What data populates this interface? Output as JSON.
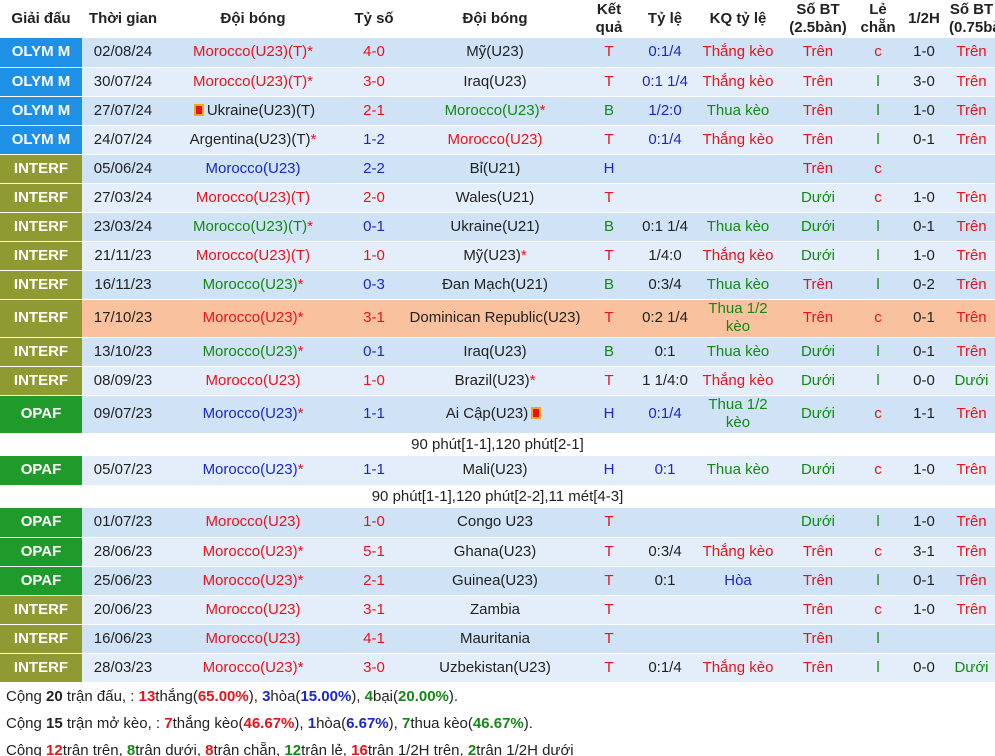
{
  "headers": [
    "Giải đấu",
    "Thời gian",
    "Đội bóng",
    "Tỷ số",
    "Đội bóng",
    "Kết quả",
    "Tỷ lệ",
    "KQ tỷ lệ",
    "Số BT (2.5bàn)",
    "Lẻ chẵn",
    "1/2H",
    "Số BT (0.75bàn)"
  ],
  "colors": {
    "olym": "#1e90e6",
    "interf": "#8f9a32",
    "opaf": "#1f9b2c",
    "row_even": "#cfe2f6",
    "row_odd": "#e4eefa",
    "highlight": "#f9c19e",
    "red": "#e8131b",
    "green": "#128a12",
    "blue": "#1b28c8"
  },
  "rows": [
    {
      "league": "OLYM M",
      "lc": "olym",
      "date": "02/08/24",
      "home": "Morocco(U23)(T)",
      "hstar": "*",
      "hc": "red",
      "hflag": false,
      "score": "4-0",
      "sc": "red",
      "away": "Mỹ(U23)",
      "astar": "",
      "ac": "dark",
      "aflag": false,
      "res": "T",
      "rc": "red",
      "odds": "0:1/4",
      "oc": "blue",
      "kq": "Thắng kèo",
      "kc": "red",
      "bt": "Trên",
      "bc": "red",
      "lec": "c",
      "lecc": "red",
      "half": "1-0",
      "bt2": "Trên",
      "b2c": "red"
    },
    {
      "league": "OLYM M",
      "lc": "olym",
      "date": "30/07/24",
      "home": "Morocco(U23)(T)",
      "hstar": "*",
      "hc": "red",
      "hflag": false,
      "score": "3-0",
      "sc": "red",
      "away": "Iraq(U23)",
      "astar": "",
      "ac": "dark",
      "aflag": false,
      "res": "T",
      "rc": "red",
      "odds": "0:1 1/4",
      "oc": "blue",
      "kq": "Thắng kèo",
      "kc": "red",
      "bt": "Trên",
      "bc": "red",
      "lec": "l",
      "lecc": "green",
      "half": "3-0",
      "bt2": "Trên",
      "b2c": "red"
    },
    {
      "league": "OLYM M",
      "lc": "olym",
      "date": "27/07/24",
      "home": "Ukraine(U23)(T)",
      "hstar": "",
      "hc": "dark",
      "hflag": true,
      "score": "2-1",
      "sc": "red",
      "away": "Morocco(U23)",
      "astar": "*",
      "ac": "green",
      "aflag": false,
      "res": "B",
      "rc": "green",
      "odds": "1/2:0",
      "oc": "blue",
      "kq": "Thua kèo",
      "kc": "green",
      "bt": "Trên",
      "bc": "red",
      "lec": "l",
      "lecc": "green",
      "half": "1-0",
      "bt2": "Trên",
      "b2c": "red"
    },
    {
      "league": "OLYM M",
      "lc": "olym",
      "date": "24/07/24",
      "home": "Argentina(U23)(T)",
      "hstar": "*",
      "hc": "dark",
      "hflag": false,
      "score": "1-2",
      "sc": "blue",
      "away": "Morocco(U23)",
      "astar": "",
      "ac": "red",
      "aflag": false,
      "res": "T",
      "rc": "red",
      "odds": "0:1/4",
      "oc": "blue",
      "kq": "Thắng kèo",
      "kc": "red",
      "bt": "Trên",
      "bc": "red",
      "lec": "l",
      "lecc": "green",
      "half": "0-1",
      "bt2": "Trên",
      "b2c": "red"
    },
    {
      "league": "INTERF",
      "lc": "interf",
      "date": "05/06/24",
      "home": "Morocco(U23)",
      "hstar": "",
      "hc": "blue",
      "hflag": false,
      "score": "2-2",
      "sc": "blue",
      "away": "Bỉ(U21)",
      "astar": "",
      "ac": "dark",
      "aflag": false,
      "res": "H",
      "rc": "blue",
      "odds": "",
      "oc": "blue",
      "kq": "",
      "kc": "dark",
      "bt": "Trên",
      "bc": "red",
      "lec": "c",
      "lecc": "red",
      "half": "",
      "bt2": "",
      "b2c": "red"
    },
    {
      "league": "INTERF",
      "lc": "interf",
      "date": "27/03/24",
      "home": "Morocco(U23)(T)",
      "hstar": "",
      "hc": "red",
      "hflag": false,
      "score": "2-0",
      "sc": "red",
      "away": "Wales(U21)",
      "astar": "",
      "ac": "dark",
      "aflag": false,
      "res": "T",
      "rc": "red",
      "odds": "",
      "oc": "blue",
      "kq": "",
      "kc": "dark",
      "bt": "Dưới",
      "bc": "green",
      "lec": "c",
      "lecc": "red",
      "half": "1-0",
      "bt2": "Trên",
      "b2c": "red"
    },
    {
      "league": "INTERF",
      "lc": "interf",
      "date": "23/03/24",
      "home": "Morocco(U23)(T)",
      "hstar": "*",
      "hc": "green",
      "hflag": false,
      "score": "0-1",
      "sc": "blue",
      "away": "Ukraine(U21)",
      "astar": "",
      "ac": "dark",
      "aflag": false,
      "res": "B",
      "rc": "green",
      "odds": "0:1 1/4",
      "oc": "dark",
      "kq": "Thua kèo",
      "kc": "green",
      "bt": "Dưới",
      "bc": "green",
      "lec": "l",
      "lecc": "green",
      "half": "0-1",
      "bt2": "Trên",
      "b2c": "red"
    },
    {
      "league": "INTERF",
      "lc": "interf",
      "date": "21/11/23",
      "home": "Morocco(U23)(T)",
      "hstar": "",
      "hc": "red",
      "hflag": false,
      "score": "1-0",
      "sc": "red",
      "away": "Mỹ(U23)",
      "astar": "*",
      "ac": "dark",
      "aflag": false,
      "res": "T",
      "rc": "red",
      "odds": "1/4:0",
      "oc": "dark",
      "kq": "Thắng kèo",
      "kc": "red",
      "bt": "Dưới",
      "bc": "green",
      "lec": "l",
      "lecc": "green",
      "half": "1-0",
      "bt2": "Trên",
      "b2c": "red"
    },
    {
      "league": "INTERF",
      "lc": "interf",
      "date": "16/11/23",
      "home": "Morocco(U23)",
      "hstar": "*",
      "hc": "green",
      "hflag": false,
      "score": "0-3",
      "sc": "blue",
      "away": "Đan Mạch(U21)",
      "astar": "",
      "ac": "dark",
      "aflag": false,
      "res": "B",
      "rc": "green",
      "odds": "0:3/4",
      "oc": "dark",
      "kq": "Thua kèo",
      "kc": "green",
      "bt": "Trên",
      "bc": "red",
      "lec": "l",
      "lecc": "green",
      "half": "0-2",
      "bt2": "Trên",
      "b2c": "red"
    },
    {
      "league": "INTERF",
      "lc": "interf",
      "date": "17/10/23",
      "home": "Morocco(U23)",
      "hstar": "*",
      "hc": "red",
      "hflag": false,
      "score": "3-1",
      "sc": "red",
      "away": "Dominican Republic(U23)",
      "astar": "",
      "ac": "dark",
      "aflag": false,
      "res": "T",
      "rc": "red",
      "odds": "0:2 1/4",
      "oc": "dark",
      "kq": "Thua 1/2 kèo",
      "kc": "green",
      "bt": "Trên",
      "bc": "red",
      "lec": "c",
      "lecc": "red",
      "half": "0-1",
      "bt2": "Trên",
      "b2c": "red",
      "highlight": true,
      "tall": true
    },
    {
      "league": "INTERF",
      "lc": "interf",
      "date": "13/10/23",
      "home": "Morocco(U23)",
      "hstar": "*",
      "hc": "green",
      "hflag": false,
      "score": "0-1",
      "sc": "blue",
      "away": "Iraq(U23)",
      "astar": "",
      "ac": "dark",
      "aflag": false,
      "res": "B",
      "rc": "green",
      "odds": "0:1",
      "oc": "dark",
      "kq": "Thua kèo",
      "kc": "green",
      "bt": "Dưới",
      "bc": "green",
      "lec": "l",
      "lecc": "green",
      "half": "0-1",
      "bt2": "Trên",
      "b2c": "red"
    },
    {
      "league": "INTERF",
      "lc": "interf",
      "date": "08/09/23",
      "home": "Morocco(U23)",
      "hstar": "",
      "hc": "red",
      "hflag": false,
      "score": "1-0",
      "sc": "red",
      "away": "Brazil(U23)",
      "astar": "*",
      "ac": "dark",
      "aflag": false,
      "res": "T",
      "rc": "red",
      "odds": "1 1/4:0",
      "oc": "dark",
      "kq": "Thắng kèo",
      "kc": "red",
      "bt": "Dưới",
      "bc": "green",
      "lec": "l",
      "lecc": "green",
      "half": "0-0",
      "bt2": "Dưới",
      "b2c": "green"
    },
    {
      "league": "OPAF",
      "lc": "opaf",
      "date": "09/07/23",
      "home": "Morocco(U23)",
      "hstar": "*",
      "hc": "blue",
      "hflag": false,
      "score": "1-1",
      "sc": "blue",
      "away": "Ai Cập(U23)",
      "astar": "",
      "ac": "dark",
      "aflag": true,
      "res": "H",
      "rc": "blue",
      "odds": "0:1/4",
      "oc": "blue",
      "kq": "Thua 1/2 kèo",
      "kc": "green",
      "bt": "Dưới",
      "bc": "green",
      "lec": "c",
      "lecc": "red",
      "half": "1-1",
      "bt2": "Trên",
      "b2c": "red",
      "tall": true,
      "note": "90 phút[1-1],120 phút[2-1]"
    },
    {
      "league": "OPAF",
      "lc": "opaf",
      "date": "05/07/23",
      "home": "Morocco(U23)",
      "hstar": "*",
      "hc": "blue",
      "hflag": false,
      "score": "1-1",
      "sc": "blue",
      "away": "Mali(U23)",
      "astar": "",
      "ac": "dark",
      "aflag": false,
      "res": "H",
      "rc": "blue",
      "odds": "0:1",
      "oc": "blue",
      "kq": "Thua kèo",
      "kc": "green",
      "bt": "Dưới",
      "bc": "green",
      "lec": "c",
      "lecc": "red",
      "half": "1-0",
      "bt2": "Trên",
      "b2c": "red",
      "note": "90 phút[1-1],120 phút[2-2],11 mét[4-3]"
    },
    {
      "league": "OPAF",
      "lc": "opaf",
      "date": "01/07/23",
      "home": "Morocco(U23)",
      "hstar": "",
      "hc": "red",
      "hflag": false,
      "score": "1-0",
      "sc": "red",
      "away": "Congo U23",
      "astar": "",
      "ac": "dark",
      "aflag": false,
      "res": "T",
      "rc": "red",
      "odds": "",
      "oc": "dark",
      "kq": "",
      "kc": "dark",
      "bt": "Dưới",
      "bc": "green",
      "lec": "l",
      "lecc": "green",
      "half": "1-0",
      "bt2": "Trên",
      "b2c": "red"
    },
    {
      "league": "OPAF",
      "lc": "opaf",
      "date": "28/06/23",
      "home": "Morocco(U23)",
      "hstar": "*",
      "hc": "red",
      "hflag": false,
      "score": "5-1",
      "sc": "red",
      "away": "Ghana(U23)",
      "astar": "",
      "ac": "dark",
      "aflag": false,
      "res": "T",
      "rc": "red",
      "odds": "0:3/4",
      "oc": "dark",
      "kq": "Thắng kèo",
      "kc": "red",
      "bt": "Trên",
      "bc": "red",
      "lec": "c",
      "lecc": "red",
      "half": "3-1",
      "bt2": "Trên",
      "b2c": "red"
    },
    {
      "league": "OPAF",
      "lc": "opaf",
      "date": "25/06/23",
      "home": "Morocco(U23)",
      "hstar": "*",
      "hc": "red",
      "hflag": false,
      "score": "2-1",
      "sc": "red",
      "away": "Guinea(U23)",
      "astar": "",
      "ac": "dark",
      "aflag": false,
      "res": "T",
      "rc": "red",
      "odds": "0:1",
      "oc": "dark",
      "kq": "Hòa",
      "kc": "blue",
      "bt": "Trên",
      "bc": "red",
      "lec": "l",
      "lecc": "green",
      "half": "0-1",
      "bt2": "Trên",
      "b2c": "red"
    },
    {
      "league": "INTERF",
      "lc": "interf",
      "date": "20/06/23",
      "home": "Morocco(U23)",
      "hstar": "",
      "hc": "red",
      "hflag": false,
      "score": "3-1",
      "sc": "red",
      "away": "Zambia",
      "astar": "",
      "ac": "dark",
      "aflag": false,
      "res": "T",
      "rc": "red",
      "odds": "",
      "oc": "dark",
      "kq": "",
      "kc": "dark",
      "bt": "Trên",
      "bc": "red",
      "lec": "c",
      "lecc": "red",
      "half": "1-0",
      "bt2": "Trên",
      "b2c": "red"
    },
    {
      "league": "INTERF",
      "lc": "interf",
      "date": "16/06/23",
      "home": "Morocco(U23)",
      "hstar": "",
      "hc": "red",
      "hflag": false,
      "score": "4-1",
      "sc": "red",
      "away": "Mauritania",
      "astar": "",
      "ac": "dark",
      "aflag": false,
      "res": "T",
      "rc": "red",
      "odds": "",
      "oc": "dark",
      "kq": "",
      "kc": "dark",
      "bt": "Trên",
      "bc": "red",
      "lec": "l",
      "lecc": "green",
      "half": "",
      "bt2": "",
      "b2c": "red"
    },
    {
      "league": "INTERF",
      "lc": "interf",
      "date": "28/03/23",
      "home": "Morocco(U23)",
      "hstar": "*",
      "hc": "red",
      "hflag": false,
      "score": "3-0",
      "sc": "red",
      "away": "Uzbekistan(U23)",
      "astar": "",
      "ac": "dark",
      "aflag": false,
      "res": "T",
      "rc": "red",
      "odds": "0:1/4",
      "oc": "dark",
      "kq": "Thắng kèo",
      "kc": "red",
      "bt": "Trên",
      "bc": "red",
      "lec": "l",
      "lecc": "green",
      "half": "0-0",
      "bt2": "Dưới",
      "b2c": "green"
    }
  ],
  "summary": [
    [
      [
        "t",
        "Cộng "
      ],
      [
        "b",
        "20"
      ],
      [
        "t",
        " trận đấu, : "
      ],
      [
        "rb",
        "13"
      ],
      [
        "t",
        "thắng("
      ],
      [
        "rb",
        "65.00%"
      ],
      [
        "t",
        "), "
      ],
      [
        "bb",
        "3"
      ],
      [
        "t",
        "hòa("
      ],
      [
        "bb",
        "15.00%"
      ],
      [
        "t",
        "), "
      ],
      [
        "gb",
        "4"
      ],
      [
        "t",
        "bại("
      ],
      [
        "gb",
        "20.00%"
      ],
      [
        "t",
        ")."
      ]
    ],
    [
      [
        "t",
        "Cộng "
      ],
      [
        "b",
        "15"
      ],
      [
        "t",
        " trận mở kèo, : "
      ],
      [
        "rb",
        "7"
      ],
      [
        "t",
        "thắng kèo("
      ],
      [
        "rb",
        "46.67%"
      ],
      [
        "t",
        "), "
      ],
      [
        "bb",
        "1"
      ],
      [
        "t",
        "hòa("
      ],
      [
        "bb",
        "6.67%"
      ],
      [
        "t",
        "), "
      ],
      [
        "gb",
        "7"
      ],
      [
        "t",
        "thua kèo("
      ],
      [
        "gb",
        "46.67%"
      ],
      [
        "t",
        ")."
      ]
    ],
    [
      [
        "t",
        "Cộng "
      ],
      [
        "rb",
        "12"
      ],
      [
        "t",
        "trận trên, "
      ],
      [
        "gb",
        "8"
      ],
      [
        "t",
        "trận dưới, "
      ],
      [
        "rb",
        "8"
      ],
      [
        "t",
        "trận chẵn, "
      ],
      [
        "gb",
        "12"
      ],
      [
        "t",
        "trận lẻ, "
      ],
      [
        "rb",
        "16"
      ],
      [
        "t",
        "trận 1/2H trên, "
      ],
      [
        "gb",
        "2"
      ],
      [
        "t",
        "trận 1/2H dưới"
      ]
    ]
  ]
}
